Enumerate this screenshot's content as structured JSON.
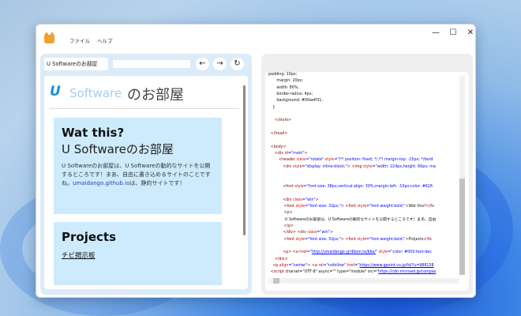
{
  "window": {
    "controls": {
      "minimize": "—",
      "maximize": "☐",
      "close": "✕"
    }
  },
  "menu": {
    "items": [
      "ファイル",
      "ヘルプ"
    ]
  },
  "browser": {
    "tab_title": "U Softwareのお部屋",
    "url": "",
    "back": "←",
    "forward": "→",
    "reload": "↻"
  },
  "page": {
    "logo_mark": "U",
    "logo_text": "Software",
    "logo_suffix": "のお部屋",
    "about": {
      "heading": "Wat this?",
      "subheading": "U Softwareのお部屋",
      "text_before": "U Softwareのお部屋は、U Softwareの動的なサイトを公開するところです！まあ、自由に書き込めるサイトのことですね。",
      "link": "umaidango.github.io",
      "text_after": "は、静的サイトです！"
    },
    "projects": {
      "heading": "Projects",
      "link": "チビ掲示板"
    }
  },
  "source": {
    "lines": [
      [
        [
          "padding: 10px;",
          "t"
        ]
      ],
      [
        [
          "        margin: 20px;",
          "t"
        ]
      ],
      [
        [
          "        width: 80%;",
          "t"
        ]
      ],
      [
        [
          "        border-radius: 4px;",
          "t"
        ]
      ],
      [
        [
          "        background: #00aeff31;",
          "t"
        ]
      ],
      [
        [
          "    }",
          "t"
        ]
      ],
      [
        [
          "",
          "t"
        ]
      ],
      [
        [
          "      </style>",
          "tag"
        ]
      ],
      [
        [
          "",
          "t"
        ]
      ],
      [
        [
          "  </head>",
          "tag"
        ]
      ],
      [
        [
          "",
          "t"
        ]
      ],
      [
        [
          "  <body>",
          "tag"
        ]
      ],
      [
        [
          "      <div ",
          "tag"
        ],
        [
          "id",
          "attr"
        ],
        [
          "=\"main\"",
          "val"
        ],
        [
          ">",
          "tag"
        ]
      ],
      [
        [
          "          <header ",
          "tag"
        ],
        [
          "class",
          "attr"
        ],
        [
          "=\"rotate\" ",
          "val"
        ],
        [
          "style",
          "attr"
        ],
        [
          "=\"/*! position: fixed; */ /*! margin-top: -15px; */bord",
          "val"
        ]
      ],
      [
        [
          "              <div ",
          "tag"
        ],
        [
          "style",
          "attr"
        ],
        [
          "=\"display: inline-block;\"",
          "val"
        ],
        [
          ">  <img ",
          "tag"
        ],
        [
          "style",
          "attr"
        ],
        [
          "=\"width: 224px;height: 60px; ma",
          "val"
        ]
      ],
      [
        [
          "",
          "t"
        ]
      ],
      [
        [
          "",
          "t"
        ]
      ],
      [
        [
          "              <font ",
          "tag"
        ],
        [
          "style",
          "attr"
        ],
        [
          "=\"font-size: 38px;vertical-align: 39%;margin-left: -10px;color: #626",
          "val"
        ]
      ],
      [
        [
          "",
          "t"
        ]
      ],
      [
        [
          "              <div ",
          "tag"
        ],
        [
          "class",
          "attr"
        ],
        [
          "=\"win\"",
          "val"
        ],
        [
          ">",
          "tag"
        ]
      ],
      [
        [
          "               <font ",
          "tag"
        ],
        [
          "style",
          "attr"
        ],
        [
          "=\"font-size: 32px;\"",
          "val"
        ],
        [
          "> <font ",
          "tag"
        ],
        [
          "style",
          "attr"
        ],
        [
          "=\"font-weight:bold;\"",
          "val"
        ],
        [
          ">",
          "tag"
        ],
        [
          "Wat this?",
          "t"
        ],
        [
          "</fo",
          "tag"
        ]
      ],
      [
        [
          "               <p>",
          "tag"
        ]
      ],
      [
        [
          "                U Softwareのお部屋は、U Softwareの動的なサイトを公開するところです！まあ、自由",
          "t"
        ]
      ],
      [
        [
          "               </p>",
          "tag"
        ]
      ],
      [
        [
          "              </div> <div ",
          "tag"
        ],
        [
          "class",
          "attr"
        ],
        [
          "=\"win\"",
          "val"
        ],
        [
          ">",
          "tag"
        ]
      ],
      [
        [
          "               <font ",
          "tag"
        ],
        [
          "style",
          "attr"
        ],
        [
          "=\"font-size: 32px;\"",
          "val"
        ],
        [
          "> <font ",
          "tag"
        ],
        [
          "style",
          "attr"
        ],
        [
          "=\"font-weight:bold;\"",
          "val"
        ],
        [
          ">",
          "tag"
        ],
        [
          "Projects",
          "t"
        ],
        [
          "</fo",
          "tag"
        ]
      ],
      [
        [
          "",
          "t"
        ]
      ],
      [
        [
          "              <p> <a ",
          "tag"
        ],
        [
          "href",
          "attr"
        ],
        [
          "=\"",
          "val"
        ],
        [
          "http://umaidango.yjribbon.to/bbs/",
          "val u"
        ],
        [
          "\" ",
          "val"
        ],
        [
          "style",
          "attr"
        ],
        [
          "=\"color: #000;text-dec",
          "val"
        ]
      ],
      [
        [
          "      </div>",
          "tag"
        ]
      ],
      [
        [
          "    <p ",
          "tag"
        ],
        [
          "align",
          "attr"
        ],
        [
          "=\"center\"",
          "val"
        ],
        [
          ">  <a ",
          "tag"
        ],
        [
          "rel",
          "attr"
        ],
        [
          "=\"nofollow\" ",
          "val"
        ],
        [
          "href",
          "attr"
        ],
        [
          "=\"",
          "val"
        ],
        [
          "https://www.gpoint.co.jp/fd/?u=988158",
          "val u"
        ]
      ],
      [
        [
          "  <script ",
          "tag"
        ],
        [
          "charset=\"UTF-8\" async=\"\" type=\"module\" src=\"",
          "t"
        ],
        [
          "https://cdn.microad.jp/compas",
          "val u"
        ]
      ]
    ]
  }
}
